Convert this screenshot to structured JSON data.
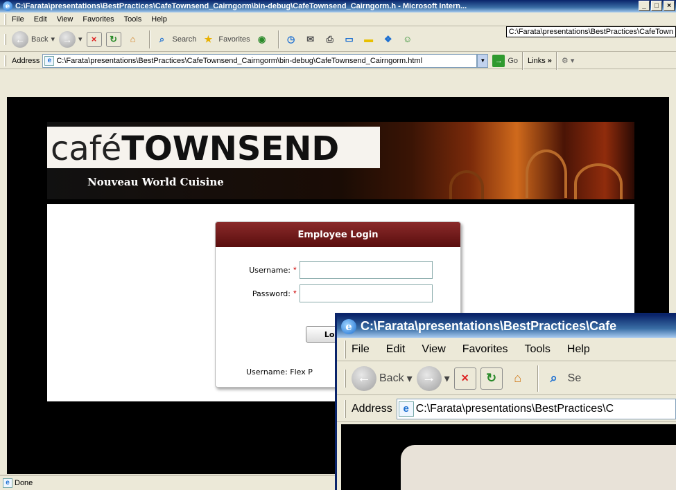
{
  "window1": {
    "title": "C:\\Farata\\presentations\\BestPractices\\CafeTownsend_Cairngorm\\bin-debug\\CafeTownsend_Cairngorm.h - Microsoft Intern...",
    "controls": {
      "minimize": "_",
      "maximize": "□",
      "close": "×"
    },
    "menu": [
      "File",
      "Edit",
      "View",
      "Favorites",
      "Tools",
      "Help"
    ],
    "tooltip": "C:\\Farata\\presentations\\BestPractices\\CafeTown",
    "toolbar": {
      "back_label": "Back",
      "search_label": "Search",
      "favorites_label": "Favorites",
      "stop_glyph": "×",
      "refresh_glyph": "↻",
      "home_glyph": "⌂",
      "search_glyph": "⌕",
      "favorites_glyph": "★",
      "media_glyph": "◉",
      "history_glyph": "◷",
      "mail_glyph": "✉",
      "print_glyph": "⎙",
      "edit_glyph": "▭",
      "folder_glyph": "▬",
      "research_glyph": "❖",
      "messenger_glyph": "☺",
      "dropdown_glyph": "▾"
    },
    "address": {
      "label": "Address",
      "url": "C:\\Farata\\presentations\\BestPractices\\CafeTownsend_Cairngorm\\bin-debug\\CafeTownsend_Cairngorm.html",
      "go_label": "Go",
      "links_label": "Links",
      "links_chevron": "»"
    },
    "status": "Done"
  },
  "page": {
    "logo_cafe": "café",
    "logo_townsend": "TOWNSEND",
    "tagline": "Nouveau World Cuisine",
    "login": {
      "header": "Employee Login",
      "username_label": "Username:",
      "password_label": "Password:",
      "required_mark": "*",
      "button_label": "Logi",
      "hint": "Username: Flex   P"
    }
  },
  "window2": {
    "title": "C:\\Farata\\presentations\\BestPractices\\Cafe",
    "menu": [
      "File",
      "Edit",
      "View",
      "Favorites",
      "Tools",
      "Help"
    ],
    "back_label": "Back",
    "search_label": "Se",
    "address_label": "Address",
    "address_url": "C:\\Farata\\presentations\\BestPractices\\C"
  },
  "colors": {
    "login_header": "#6e1a1a",
    "page_background": "#000000",
    "titlebar": "#0a246a"
  }
}
